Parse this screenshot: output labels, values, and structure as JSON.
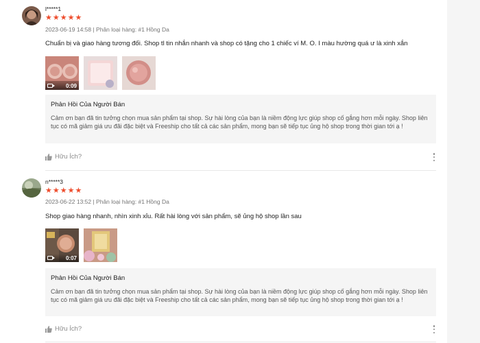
{
  "reviews": [
    {
      "username": "l*****1",
      "rating": 5,
      "meta": "2023-06-19 14:58 | Phân loại hàng: #1 Hồng Da",
      "comment": "Chuẩn bị và giao hàng tương đối. Shop tl tin nhắn nhanh và shop có tặng cho 1 chiếc ví M. O. I màu hường quá ư là xinh xắn",
      "media": [
        {
          "type": "video",
          "duration": "0:09",
          "icon": "video-icon"
        },
        {
          "type": "image"
        },
        {
          "type": "image"
        }
      ],
      "reply_title": "Phản Hồi Của Người Bán",
      "reply_text": "Cảm ơn bạn đã tin tưởng chọn mua sản phẩm tại shop. Sự hài lòng của bạn là niềm động lực giúp shop cố gắng hơn mỗi ngày. Shop liên tục có mã giảm giá ưu đãi đặc biệt và Freeship cho tất cả các sản phẩm, mong bạn sẽ tiếp tục ủng hộ shop trong thời gian tới ạ !",
      "helpful_label": "Hữu Ích?"
    },
    {
      "username": "n*****3",
      "rating": 5,
      "meta": "2023-06-22 13:52 | Phân loại hàng: #1 Hồng Da",
      "comment": "Shop giao hàng nhanh, nhìn xinh xỉu. Rất hài lòng với sản phẩm, sẽ ủng hộ shop lần sau",
      "media": [
        {
          "type": "video",
          "duration": "0:07",
          "icon": "video-icon"
        },
        {
          "type": "image"
        }
      ],
      "reply_title": "Phản Hồi Của Người Bán",
      "reply_text": "Cảm ơn bạn đã tin tưởng chọn mua sản phẩm tại shop. Sự hài lòng của bạn là niềm động lực giúp shop cố gắng hơn mỗi ngày. Shop liên tục có mã giảm giá ưu đãi đặc biệt và Freeship cho tất cả các sản phẩm, mong bạn sẽ tiếp tục ủng hộ shop trong thời gian tới ạ !",
      "helpful_label": "Hữu Ích?"
    }
  ],
  "colors": {
    "star": "#ee4d2d",
    "reply_bg": "#f5f5f5",
    "meta": "#757575"
  },
  "icons": {
    "star": "star-icon",
    "like": "thumbs-up-icon",
    "more": "more-vertical-icon"
  }
}
